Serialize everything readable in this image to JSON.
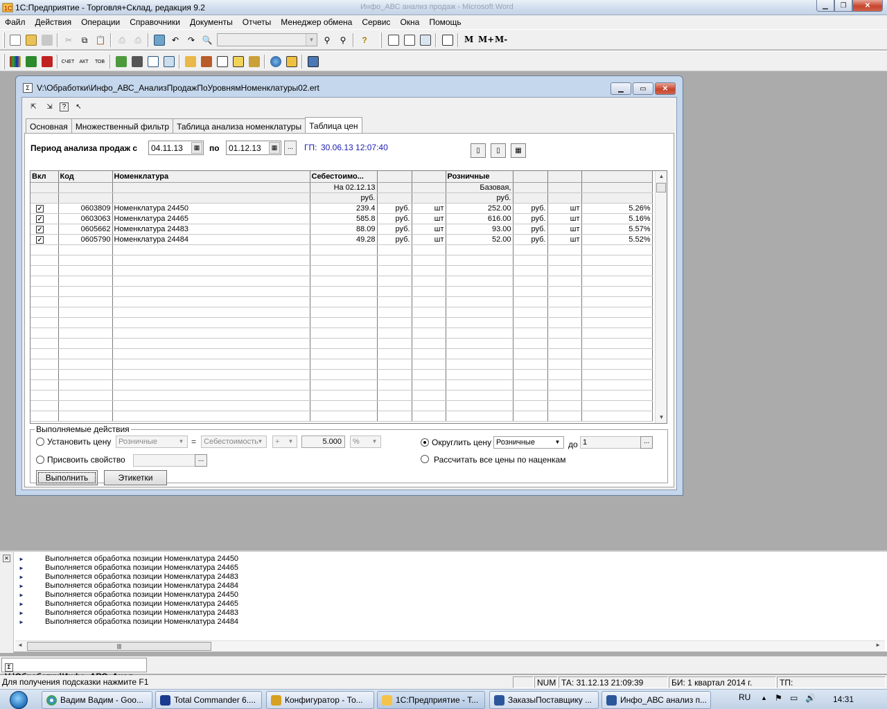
{
  "app": {
    "title": "1С:Предприятие - Торговля+Склад, редакция 9.2",
    "ghost_title": "Инфо_АВС анализ продаж - Microsoft Word"
  },
  "menu": [
    "Файл",
    "Действия",
    "Операции",
    "Справочники",
    "Документы",
    "Отчеты",
    "Менеджер обмена",
    "Сервис",
    "Окна",
    "Помощь"
  ],
  "toolbar": {
    "memory_m": "M",
    "memory_mplus": "M+",
    "memory_mminus": "M-",
    "toolbar2_text1": "СЧЕТ",
    "toolbar2_text2": "АКТ",
    "toolbar2_text3": "ТОВ"
  },
  "window": {
    "title": "V:\\Обработки\\Инфо_АВС_АнализПродажПоУровнямНоменклатуры02.ert",
    "tabs": [
      "Основная",
      "Множественный фильтр",
      "Таблица анализа номенклатуры",
      "Таблица цен"
    ],
    "period_label": "Период анализа продаж с",
    "date_from": "04.11.13",
    "to_label": "по",
    "date_to": "01.12.13",
    "dots": "...",
    "gp_label": "ГП:",
    "gp_value": "30.06.13 12:07:40"
  },
  "grid": {
    "headers": [
      "Вкл",
      "Код",
      "Номенклатура",
      "Себестоимо...",
      "",
      "",
      "Розничные",
      "",
      "",
      ""
    ],
    "sub1": [
      "",
      "",
      "",
      "На 02.12.13",
      "",
      "",
      "Базовая,",
      "",
      "",
      ""
    ],
    "sub2": [
      "",
      "",
      "",
      "руб.",
      "",
      "",
      "руб.",
      "",
      "",
      ""
    ],
    "rows": [
      {
        "code": "0603809",
        "name": "Номенклатура 24450",
        "cost": "239.4",
        "cur1": "руб.",
        "unit1": "шт",
        "price": "252.00",
        "cur2": "руб.",
        "unit2": "шт",
        "markup": "5.26%"
      },
      {
        "code": "0603063",
        "name": "Номенклатура 24465",
        "cost": "585.8",
        "cur1": "руб.",
        "unit1": "шт",
        "price": "616.00",
        "cur2": "руб.",
        "unit2": "шт",
        "markup": "5.16%"
      },
      {
        "code": "0605662",
        "name": "Номенклатура 24483",
        "cost": "88.09",
        "cur1": "руб.",
        "unit1": "шт",
        "price": "93.00",
        "cur2": "руб.",
        "unit2": "шт",
        "markup": "5.57%"
      },
      {
        "code": "0605790",
        "name": "Номенклатура 24484",
        "cost": "49.28",
        "cur1": "руб.",
        "unit1": "шт",
        "price": "52.00",
        "cur2": "руб.",
        "unit2": "шт",
        "markup": "5.52%"
      }
    ]
  },
  "actions": {
    "legend": "Выполняемые действия",
    "set_price_label": "Установить цену",
    "set_price_type": "Розничные",
    "equals": "=",
    "base_type": "Себестоимость",
    "op": "+",
    "amount": "5.000",
    "unit": "%",
    "assign_prop_label": "Присвоить свойство",
    "round_label": "Округлить цену",
    "round_type": "Розничные",
    "round_to_label": "до",
    "round_to_value": "1",
    "recalc_label": "Рассчитать все цены по наценкам",
    "execute_btn": "Выполнить",
    "labels_btn": "Этикетки"
  },
  "messages": [
    "Выполняется обработка позиции Номенклатура 24450",
    "Выполняется обработка позиции Номенклатура 24465",
    "Выполняется обработка позиции Номенклатура 24483",
    "Выполняется обработка позиции Номенклатура 24484",
    "Выполняется обработка позиции Номенклатура 24450",
    "Выполняется обработка позиции Номенклатура 24465",
    "Выполняется обработка позиции Номенклатура 24483",
    "Выполняется обработка позиции Номенклатура 24484"
  ],
  "window_tab": "V:\\Обработки\\Инфо_АВС_Анал...",
  "status": {
    "hint": "Для получения подсказки нажмите F1",
    "num": "NUM",
    "ta": "ТА: 31.12.13  21:09:39",
    "bi": "БИ: 1 квартал 2014 г.",
    "tp": "ТП:"
  },
  "taskbar": {
    "items": [
      "Вадим Вадим - Goo...",
      "Total Commander 6....",
      "Конфигуратор - То...",
      "1С:Предприятие - Т...",
      "ЗаказыПоставщику ...",
      "Инфо_АВС анализ п..."
    ],
    "lang": "RU",
    "time": "14:31"
  },
  "colors": {
    "accent": "#1c1cb5",
    "mdi_bg": "#ababab",
    "window_frame": "#c5d7ec"
  }
}
